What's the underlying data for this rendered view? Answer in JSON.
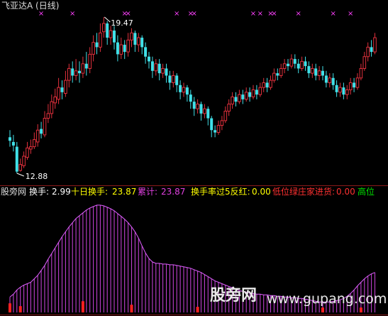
{
  "colors": {
    "background": "#000000",
    "up": "#e0303c",
    "down": "#40e0e8",
    "indicator": "#c040d0",
    "marker": "#ff40ff",
    "separator": "#8b1a1a",
    "red_flag": "#ff2020",
    "white": "#ffffff",
    "yellow": "#ffff00",
    "green": "#00e000"
  },
  "header": {
    "title": "飞亚达A (日线)"
  },
  "price_panel": {
    "high_label": "19.47",
    "low_label": "12.88"
  },
  "indicator_bar": {
    "source": "股旁网",
    "turnover_label": "换手:",
    "turnover_value": "2.99",
    "ten_day_label": "十日换手:",
    "ten_day_value": "23.87",
    "cum_label": "累计:",
    "cum_value": "23.87",
    "over5_label": "换手率过5反红:",
    "over5_value": "0.00",
    "lowpos_label": "低位绿庄家进货:",
    "lowpos_value": "0.00",
    "highpos_label": "高位"
  },
  "watermark": {
    "cn": "股旁网",
    "url": "www.gupang.com"
  },
  "chart_data": {
    "type": "candlestick",
    "y_range": [
      12.88,
      19.47
    ],
    "candles": [
      [
        14.4,
        14.25,
        14.0,
        14.7
      ],
      [
        14.2,
        14.05,
        13.8,
        14.5
      ],
      [
        14.0,
        12.95,
        12.88,
        14.2
      ],
      [
        13.0,
        13.25,
        12.95,
        13.5
      ],
      [
        13.2,
        13.6,
        13.1,
        13.8
      ],
      [
        13.55,
        13.95,
        13.45,
        14.2
      ],
      [
        13.9,
        14.0,
        13.7,
        14.3
      ],
      [
        14.0,
        14.3,
        13.9,
        14.6
      ],
      [
        14.2,
        14.7,
        14.0,
        14.95
      ],
      [
        14.75,
        14.55,
        14.35,
        15.05
      ],
      [
        14.5,
        15.2,
        14.4,
        15.5
      ],
      [
        15.2,
        15.4,
        15.0,
        15.8
      ],
      [
        15.4,
        15.9,
        15.2,
        16.2
      ],
      [
        15.85,
        16.1,
        15.6,
        16.45
      ],
      [
        16.0,
        16.5,
        15.8,
        16.9
      ],
      [
        16.5,
        16.3,
        16.0,
        16.8
      ],
      [
        16.25,
        16.8,
        16.1,
        17.2
      ],
      [
        16.8,
        17.3,
        16.5,
        17.5
      ],
      [
        17.3,
        17.0,
        16.7,
        17.6
      ],
      [
        17.0,
        17.2,
        16.8,
        17.7
      ],
      [
        17.2,
        17.1,
        16.7,
        17.6
      ],
      [
        17.1,
        17.5,
        16.9,
        17.8
      ],
      [
        17.5,
        17.3,
        17.0,
        18.0
      ],
      [
        17.3,
        17.9,
        17.1,
        18.2
      ],
      [
        17.9,
        18.4,
        17.6,
        18.7
      ],
      [
        18.4,
        18.2,
        17.9,
        18.8
      ],
      [
        18.2,
        18.8,
        18.0,
        19.2
      ],
      [
        18.85,
        19.2,
        18.6,
        19.47
      ],
      [
        19.2,
        18.6,
        18.3,
        19.3
      ],
      [
        18.6,
        18.9,
        18.3,
        19.1
      ],
      [
        18.9,
        18.4,
        18.1,
        19.1
      ],
      [
        18.4,
        17.9,
        17.6,
        18.7
      ],
      [
        17.9,
        18.3,
        17.7,
        18.6
      ],
      [
        18.3,
        18.0,
        17.7,
        18.5
      ],
      [
        18.0,
        18.5,
        17.8,
        18.8
      ],
      [
        18.5,
        18.8,
        18.2,
        19.0
      ],
      [
        18.8,
        18.3,
        18.0,
        18.9
      ],
      [
        18.3,
        18.6,
        18.0,
        18.8
      ],
      [
        18.6,
        18.2,
        17.9,
        18.7
      ],
      [
        18.2,
        17.8,
        17.5,
        18.4
      ],
      [
        17.8,
        17.6,
        17.3,
        18.0
      ],
      [
        17.6,
        17.2,
        16.9,
        17.8
      ],
      [
        17.2,
        17.5,
        17.0,
        17.7
      ],
      [
        17.5,
        17.1,
        16.8,
        17.7
      ],
      [
        17.1,
        17.3,
        16.9,
        17.5
      ],
      [
        17.3,
        17.0,
        16.7,
        17.5
      ],
      [
        17.0,
        16.7,
        16.4,
        17.2
      ],
      [
        16.7,
        17.0,
        16.5,
        17.2
      ],
      [
        17.0,
        16.6,
        16.3,
        17.1
      ],
      [
        16.6,
        16.3,
        16.0,
        16.8
      ],
      [
        16.3,
        16.5,
        16.1,
        16.7
      ],
      [
        16.5,
        16.2,
        15.9,
        16.6
      ],
      [
        16.2,
        15.9,
        15.6,
        16.4
      ],
      [
        15.9,
        15.6,
        15.3,
        16.1
      ],
      [
        15.6,
        15.8,
        15.4,
        16.0
      ],
      [
        15.8,
        15.4,
        15.1,
        15.9
      ],
      [
        15.4,
        15.6,
        15.2,
        15.8
      ],
      [
        15.6,
        15.2,
        14.9,
        15.7
      ],
      [
        15.2,
        14.7,
        14.4,
        15.3
      ],
      [
        14.7,
        14.6,
        14.4,
        14.9
      ],
      [
        14.6,
        14.9,
        14.5,
        15.1
      ],
      [
        14.9,
        15.1,
        14.7,
        15.3
      ],
      [
        15.1,
        15.5,
        15.0,
        15.7
      ],
      [
        15.5,
        15.8,
        15.3,
        16.0
      ],
      [
        15.8,
        16.1,
        15.6,
        16.3
      ],
      [
        16.1,
        15.9,
        15.7,
        16.3
      ],
      [
        15.9,
        16.2,
        15.8,
        16.4
      ],
      [
        16.2,
        16.0,
        15.8,
        16.4
      ],
      [
        16.0,
        16.3,
        15.9,
        16.5
      ],
      [
        16.3,
        16.1,
        15.9,
        16.5
      ],
      [
        16.1,
        16.4,
        16.0,
        16.6
      ],
      [
        16.4,
        16.2,
        16.0,
        16.6
      ],
      [
        16.2,
        16.5,
        16.1,
        16.7
      ],
      [
        16.5,
        16.7,
        16.3,
        16.9
      ],
      [
        16.7,
        16.5,
        16.3,
        16.9
      ],
      [
        16.5,
        16.8,
        16.4,
        17.0
      ],
      [
        16.8,
        17.1,
        16.7,
        17.3
      ],
      [
        17.1,
        17.0,
        16.8,
        17.3
      ],
      [
        17.0,
        17.3,
        16.9,
        17.5
      ],
      [
        17.3,
        17.5,
        17.1,
        17.7
      ],
      [
        17.5,
        17.4,
        17.2,
        17.7
      ],
      [
        17.4,
        17.7,
        17.3,
        17.9
      ],
      [
        17.7,
        17.5,
        17.3,
        17.9
      ],
      [
        17.5,
        17.3,
        17.1,
        17.7
      ],
      [
        17.3,
        17.6,
        17.2,
        17.8
      ],
      [
        17.6,
        17.4,
        17.2,
        17.8
      ],
      [
        17.4,
        17.1,
        16.9,
        17.6
      ],
      [
        17.1,
        17.3,
        16.9,
        17.5
      ],
      [
        17.3,
        17.0,
        16.8,
        17.5
      ],
      [
        17.0,
        17.2,
        16.8,
        17.4
      ],
      [
        17.2,
        17.0,
        16.8,
        17.4
      ],
      [
        17.0,
        16.7,
        16.5,
        17.2
      ],
      [
        16.7,
        16.9,
        16.5,
        17.1
      ],
      [
        16.9,
        16.6,
        16.4,
        17.1
      ],
      [
        16.6,
        16.3,
        16.1,
        16.8
      ],
      [
        16.3,
        16.5,
        16.1,
        16.7
      ],
      [
        16.5,
        16.2,
        16.0,
        16.7
      ],
      [
        16.2,
        16.4,
        16.0,
        16.6
      ],
      [
        16.4,
        16.7,
        16.2,
        16.9
      ],
      [
        16.7,
        16.5,
        16.3,
        16.9
      ],
      [
        16.5,
        16.9,
        16.4,
        17.1
      ],
      [
        16.9,
        17.3,
        16.8,
        17.5
      ],
      [
        17.3,
        17.8,
        17.2,
        18.0
      ],
      [
        17.8,
        18.2,
        17.6,
        18.4
      ],
      [
        18.2,
        18.0,
        17.8,
        18.5
      ],
      [
        18.0,
        18.6,
        17.9,
        18.8
      ]
    ],
    "indicator_values": [
      2.2,
      2.6,
      3.2,
      3.6,
      3.9,
      4.1,
      4.3,
      4.8,
      5.3,
      6.0,
      6.7,
      7.6,
      8.4,
      9.2,
      10.0,
      10.8,
      11.5,
      12.2,
      12.8,
      13.4,
      13.8,
      14.2,
      14.6,
      14.9,
      15.1,
      15.3,
      15.3,
      15.2,
      15.0,
      14.8,
      14.5,
      14.1,
      13.7,
      13.3,
      12.8,
      12.2,
      11.5,
      10.6,
      9.5,
      8.5,
      7.7,
      7.2,
      7.0,
      7.0,
      6.9,
      6.9,
      6.8,
      6.8,
      6.7,
      6.6,
      6.5,
      6.4,
      6.3,
      6.1,
      5.9,
      5.7,
      5.4,
      5.1,
      4.8,
      4.5,
      4.3,
      4.1,
      3.9,
      3.7,
      3.5,
      3.3,
      3.1,
      3.0,
      2.9,
      2.8,
      2.7,
      2.6,
      2.6,
      2.5,
      2.5,
      2.4,
      2.4,
      2.3,
      2.3,
      2.2,
      2.2,
      2.1,
      2.1,
      2.0,
      2.0,
      1.9,
      1.8,
      1.7,
      1.6,
      1.5,
      1.5,
      1.5,
      1.5,
      1.6,
      1.7,
      1.8,
      2.0,
      2.3,
      2.7,
      3.2,
      3.8,
      4.3,
      4.8,
      5.2,
      5.5,
      5.7
    ],
    "indicator_range": [
      0,
      16
    ],
    "red_flags": [
      [
        0,
        1.3
      ],
      [
        3,
        0.9
      ],
      [
        21,
        1.6
      ],
      [
        35,
        1.1
      ],
      [
        54,
        0.8
      ],
      [
        90,
        0.7
      ],
      [
        101,
        0.7
      ]
    ],
    "top_markers": [
      9,
      18,
      33,
      34,
      48,
      52,
      53,
      70,
      72,
      75,
      76,
      83,
      93,
      98
    ]
  }
}
